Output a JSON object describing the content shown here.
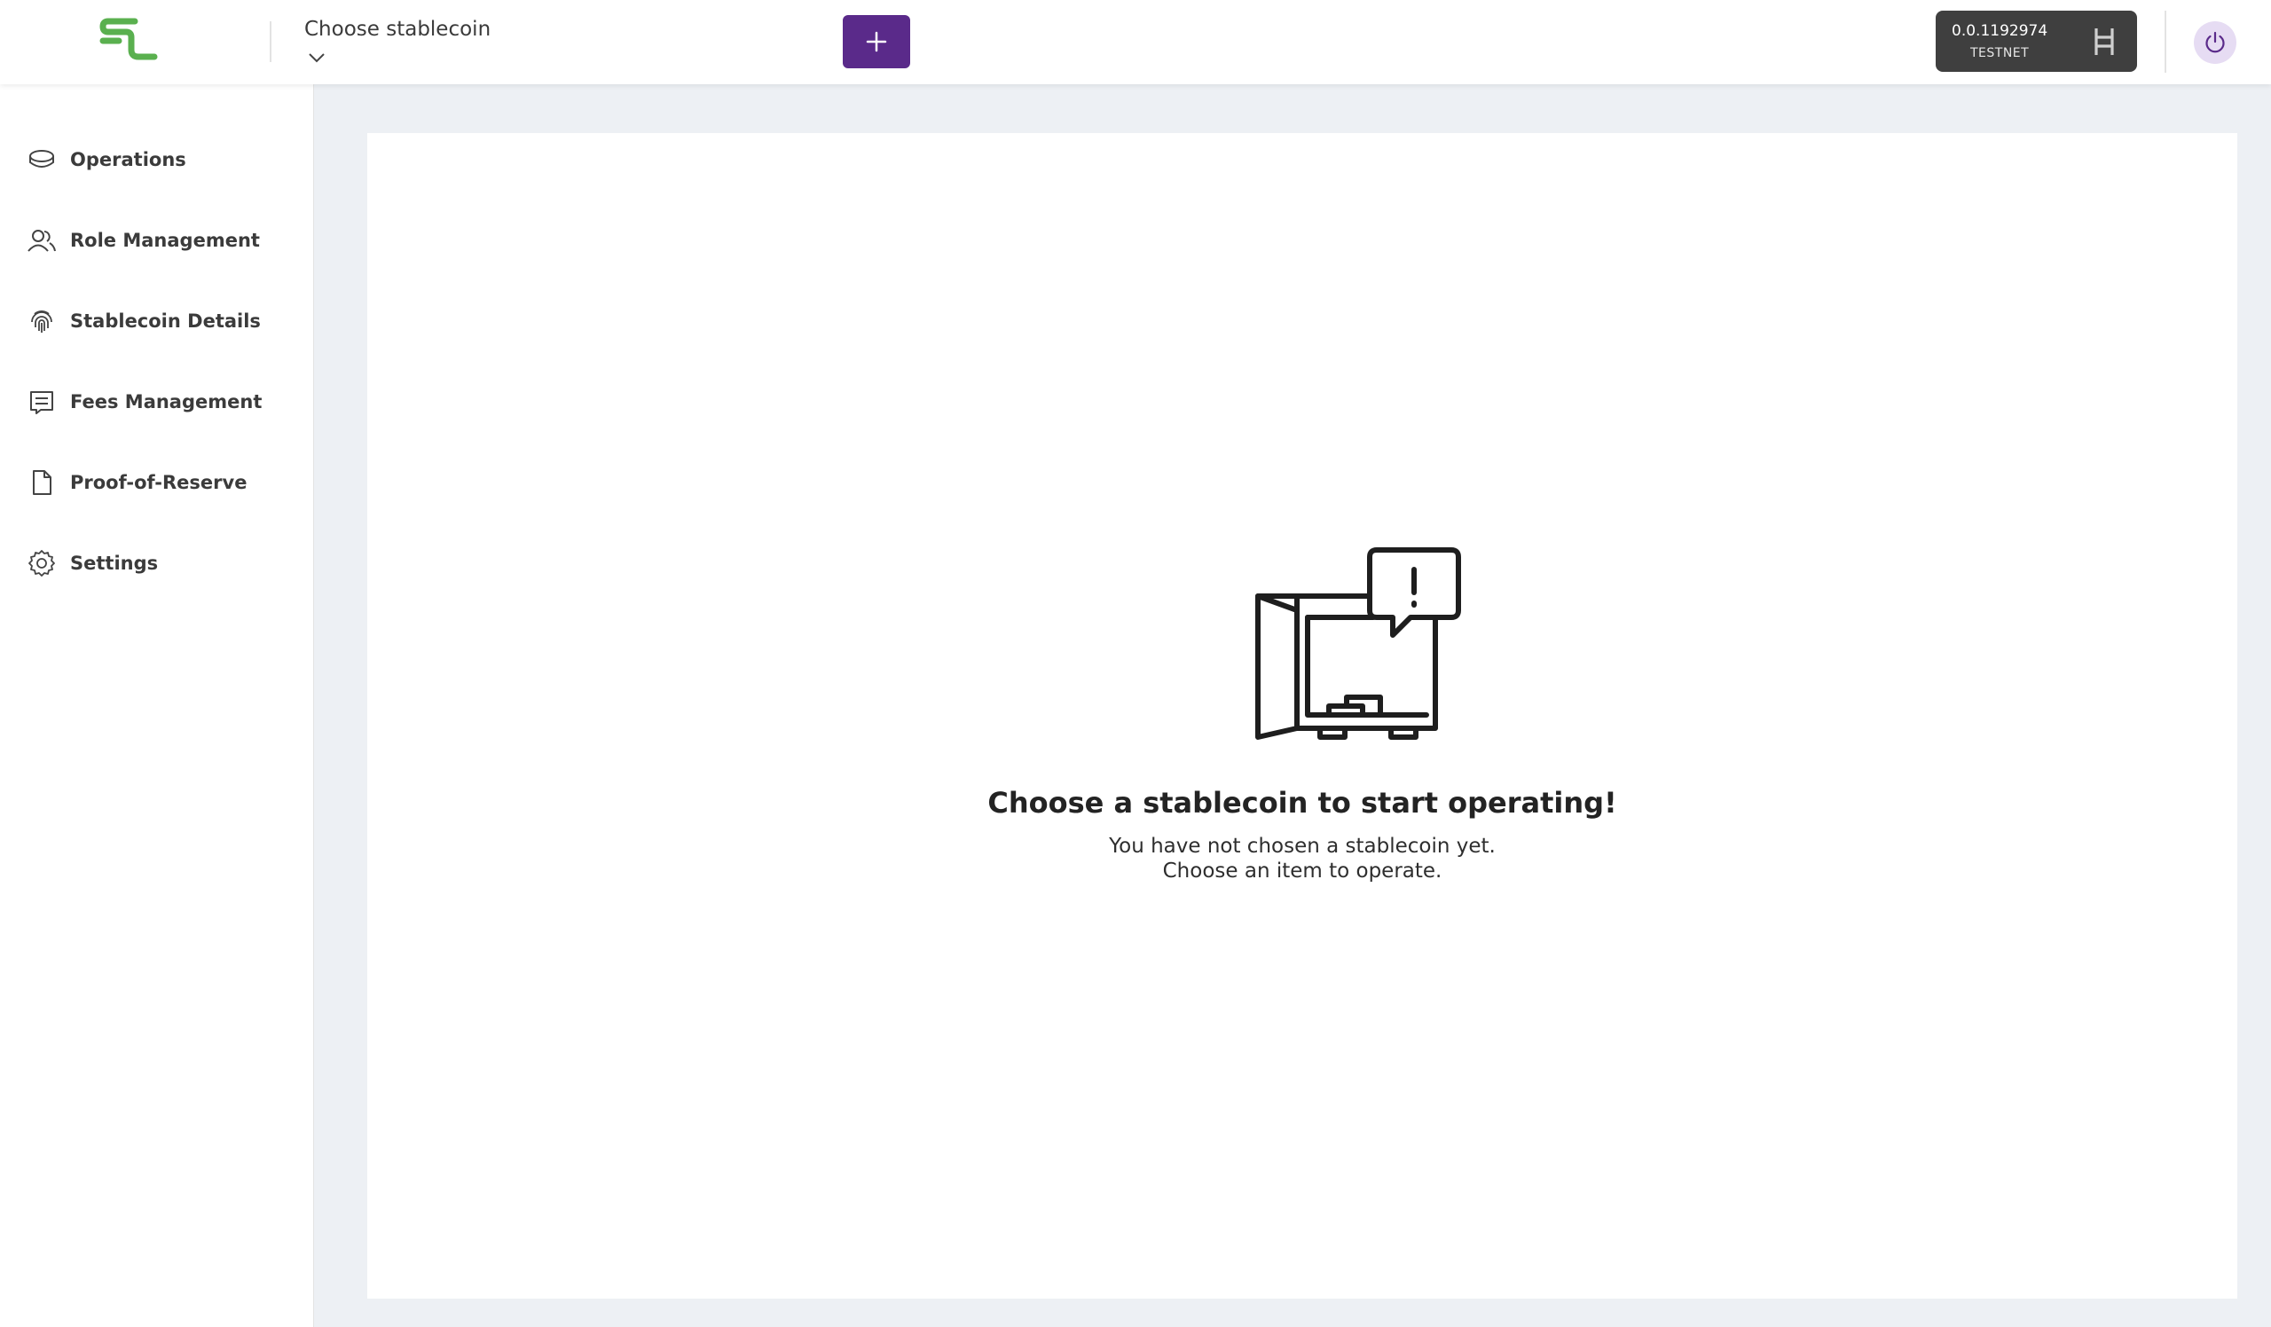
{
  "header": {
    "selector_label": "Choose stablecoin",
    "add_button_label": "+",
    "account_id": "0.0.1192974",
    "network": "TESTNET"
  },
  "sidebar": {
    "items": [
      {
        "label": "Operations",
        "icon": "coins-icon"
      },
      {
        "label": "Role Management",
        "icon": "users-icon"
      },
      {
        "label": "Stablecoin Details",
        "icon": "fingerprint-icon"
      },
      {
        "label": "Fees Management",
        "icon": "receipt-icon"
      },
      {
        "label": "Proof-of-Reserve",
        "icon": "file-icon"
      },
      {
        "label": "Settings",
        "icon": "gear-icon"
      }
    ]
  },
  "empty_state": {
    "title": "Choose a stablecoin to start operating!",
    "line1": "You have not chosen a stablecoin yet.",
    "line2": "Choose an item to operate."
  },
  "colors": {
    "brand_green": "#5ab04f",
    "accent_purple": "#5a2a8a",
    "account_bg": "#3f3f3f"
  }
}
